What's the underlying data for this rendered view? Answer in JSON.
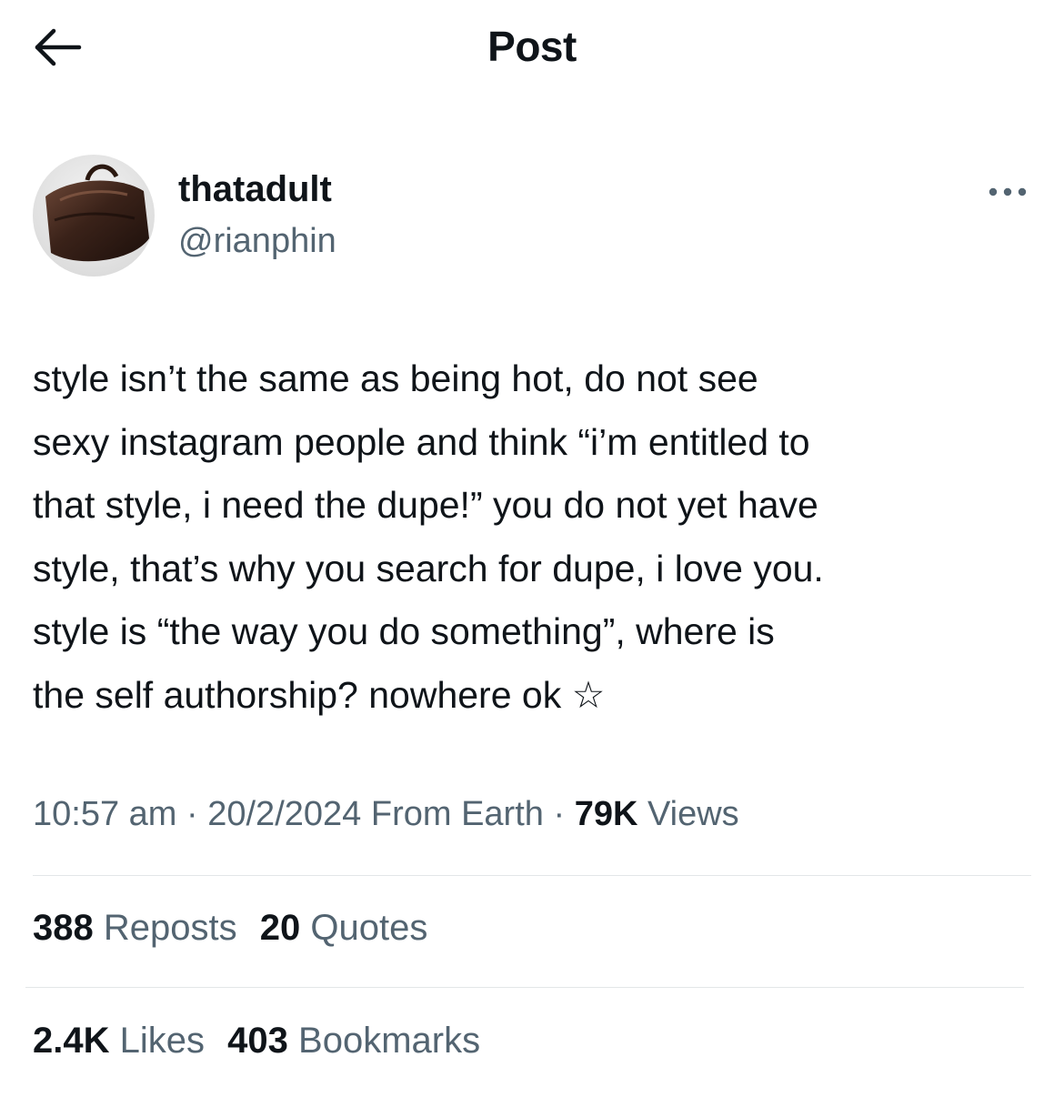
{
  "header": {
    "title": "Post",
    "back_icon": "arrow-left-icon"
  },
  "author": {
    "display_name": "thatadult",
    "handle": "@rianphin",
    "avatar": "avatar-image-bag",
    "more_icon": "more-horizontal-icon"
  },
  "post": {
    "text": "style isn’t the same as being hot, do not see\nsexy instagram people and think “i’m entitled to\nthat style, i need the dupe!” you do not yet have\nstyle, that’s why you search for dupe, i love you.\nstyle is “the way you do something”, where is\nthe self authorship? nowhere ok ☆"
  },
  "meta": {
    "time": "10:57 am",
    "separator": " · ",
    "date": "20/2/2024",
    "source": "From Earth",
    "views_count": "79K",
    "views_label": "Views"
  },
  "stats": {
    "reposts_count": "388",
    "reposts_label": "Reposts",
    "quotes_count": "20",
    "quotes_label": "Quotes",
    "likes_count": "2.4K",
    "likes_label": "Likes",
    "bookmarks_count": "403",
    "bookmarks_label": "Bookmarks"
  },
  "colors": {
    "text_primary": "#0f1419",
    "text_secondary": "#536471",
    "divider": "#e3e6e8",
    "background": "#ffffff"
  }
}
